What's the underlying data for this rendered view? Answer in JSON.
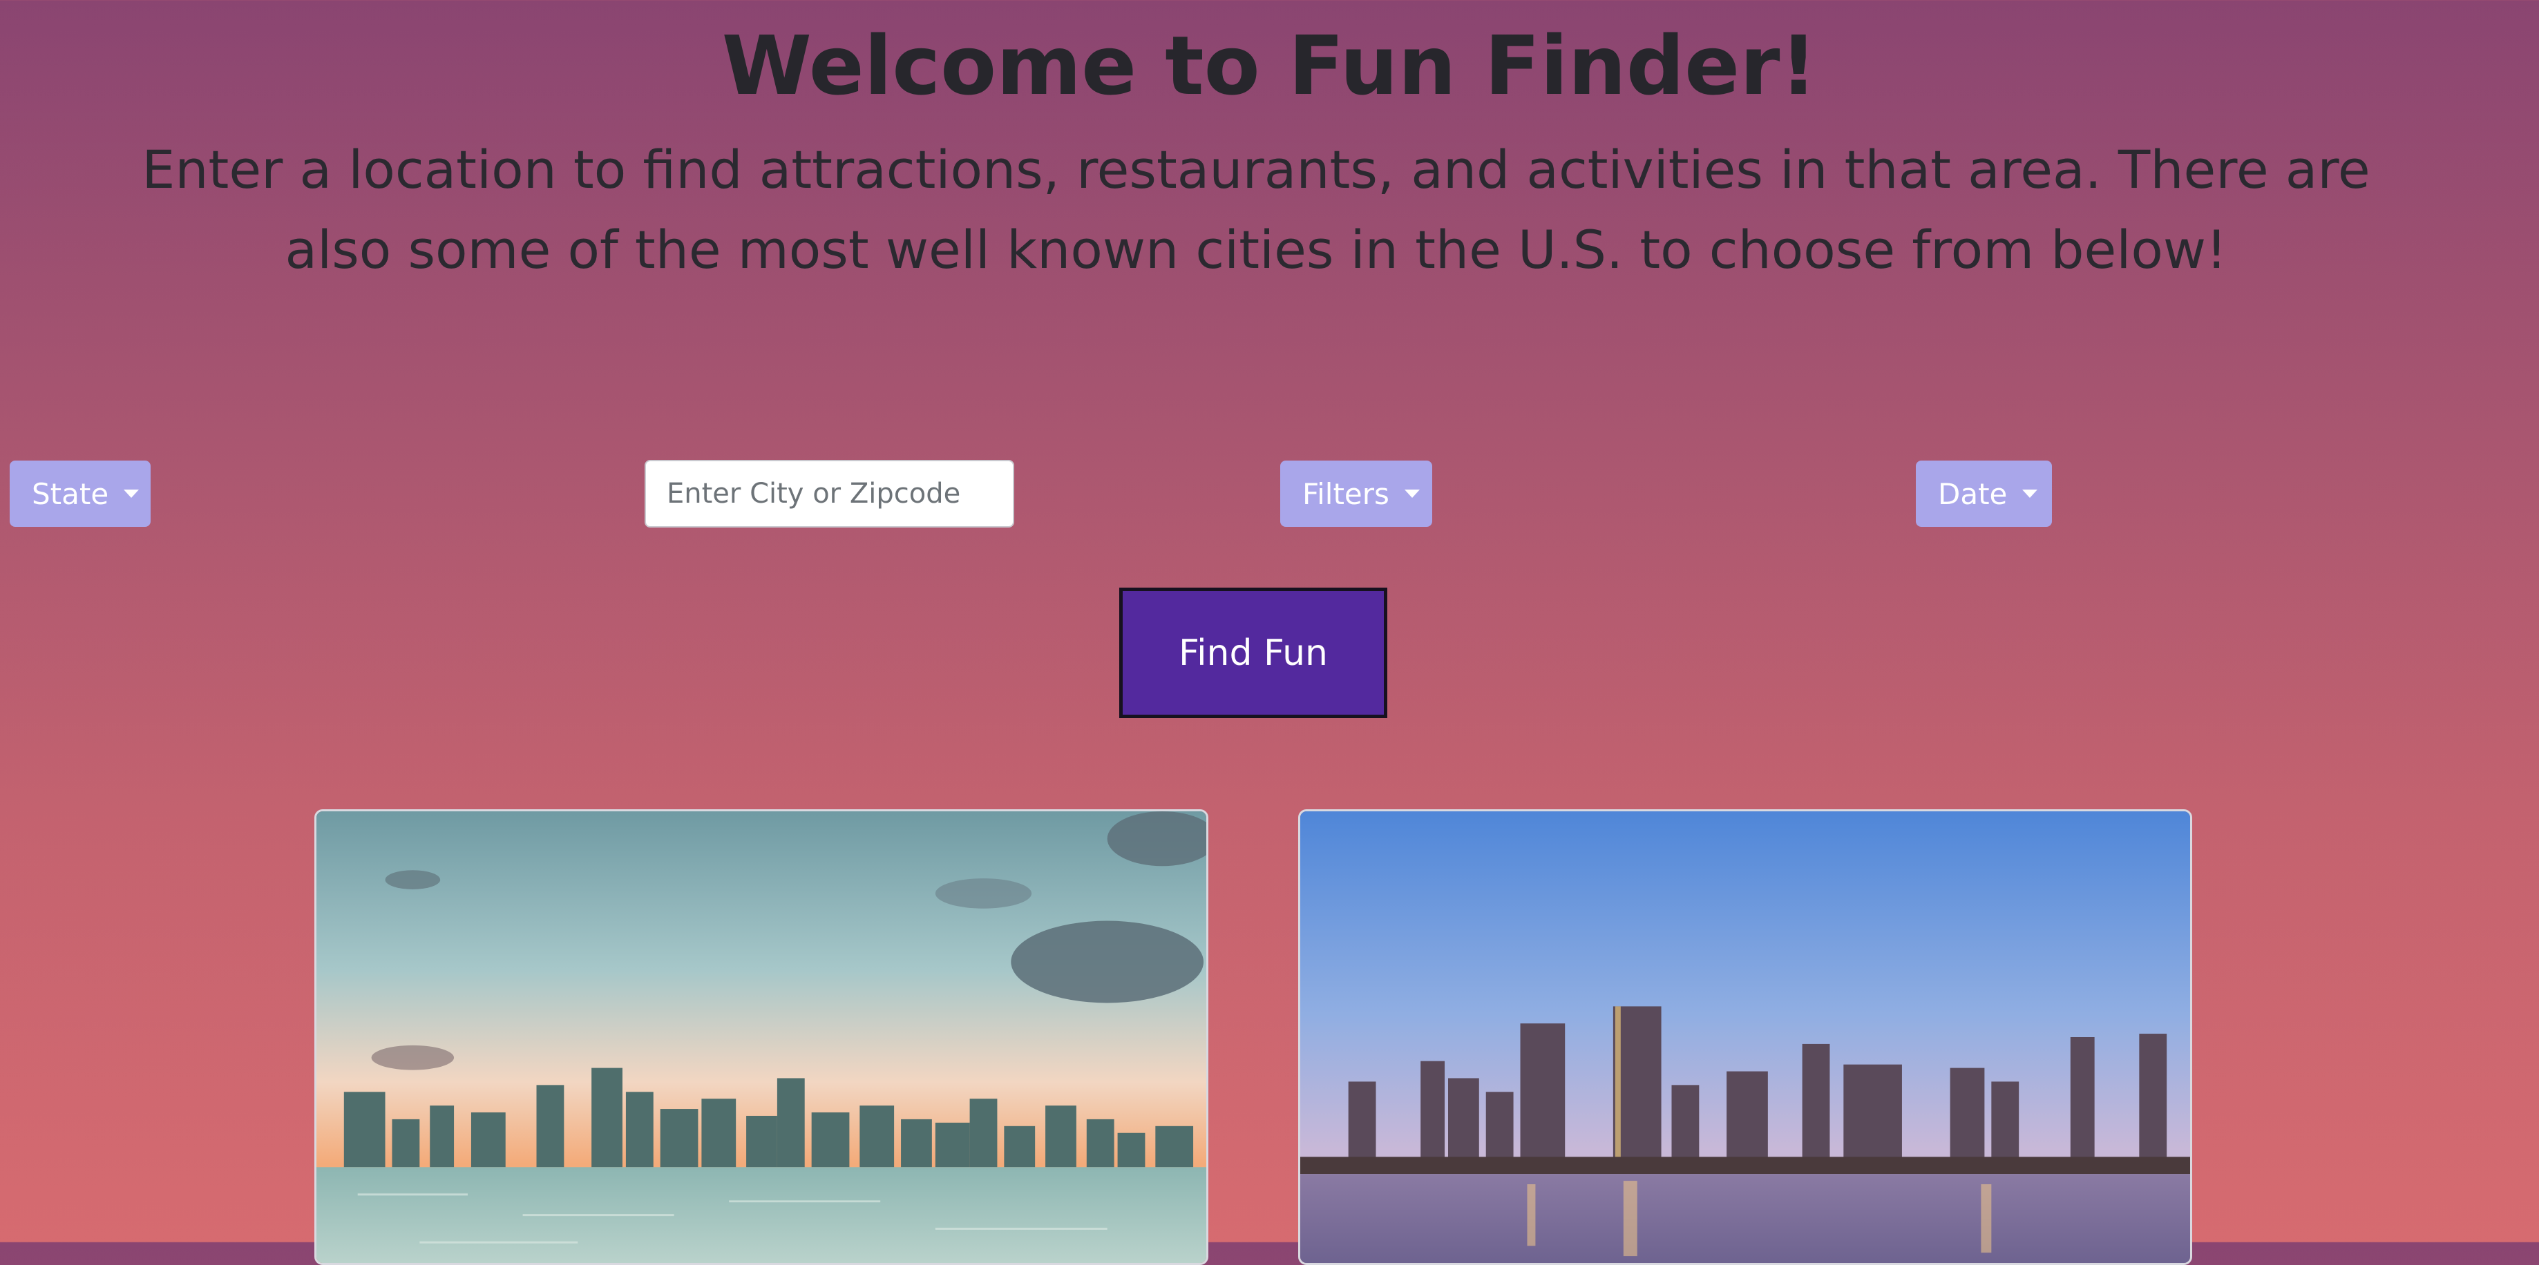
{
  "header": {
    "title": "Welcome to Fun Finder!",
    "subtitle": "Enter a location to find attractions, restaurants, and activities in that area. There are also some of the most well known cities in the U.S. to choose from below!"
  },
  "controls": {
    "state_label": "State",
    "search_placeholder": "Enter City or Zipcode",
    "search_value": "",
    "filters_label": "Filters",
    "date_label": "Date",
    "find_label": "Find Fun"
  },
  "cities": [
    {
      "icon": "miami-skyline-photo"
    },
    {
      "icon": "san-diego-skyline-photo"
    }
  ],
  "colors": {
    "dropdown": "#a9a6ea",
    "find_button": "#53299e",
    "background_top": "#8a4571",
    "background_bottom": "#d66b70"
  }
}
